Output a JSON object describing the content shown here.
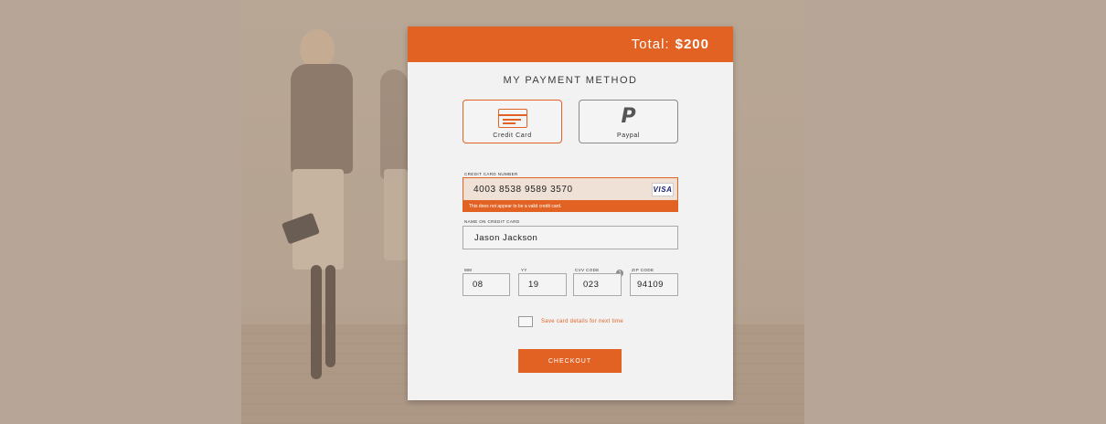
{
  "header": {
    "total_label": "Total:",
    "total_amount": "$200"
  },
  "payment": {
    "title": "MY PAYMENT METHOD",
    "methods": [
      {
        "label": "Credit Card",
        "icon": "credit-card-icon",
        "selected": true
      },
      {
        "label": "Paypal",
        "icon": "paypal-icon",
        "selected": false
      }
    ]
  },
  "fields": {
    "card_number": {
      "label": "CREDIT CARD NUMBER",
      "value": "4003 8538 9589 3570",
      "brand": "VISA",
      "error": "This does not appear to be a valid credit card."
    },
    "name": {
      "label": "NAME ON CREDIT CARD",
      "value": "Jason Jackson"
    },
    "mm": {
      "label": "MM",
      "value": "08"
    },
    "yy": {
      "label": "YY",
      "value": "19"
    },
    "cvv": {
      "label": "CVV CODE",
      "value": "023",
      "help": "?"
    },
    "zip": {
      "label": "ZIP CODE",
      "value": "94109"
    }
  },
  "save_details_label": "Save card details for next time",
  "checkout_label": "CHECKOUT",
  "colors": {
    "accent": "#e26224",
    "background": "#b7a698",
    "card": "#f2f2f3",
    "error_field": "#efe1d6"
  }
}
